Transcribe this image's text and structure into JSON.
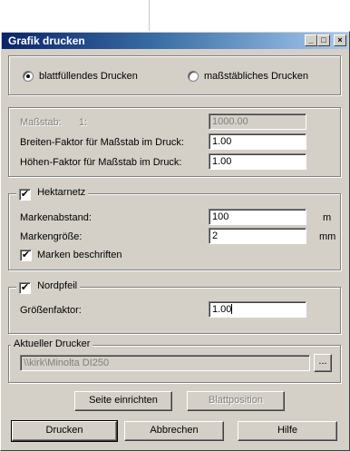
{
  "window": {
    "title": "Grafik drucken",
    "controls": {
      "minimize": "_",
      "maximize": "□",
      "close": "×"
    }
  },
  "print_mode": {
    "options": [
      "blattfüllendes Drucken",
      "maßstäbliches Drucken"
    ],
    "selected": "blattfüllendes Drucken"
  },
  "scale": {
    "label": "Maßstab:",
    "prefix": "1:",
    "value": "1000.00",
    "width_factor_label": "Breiten-Faktor für Maßstab im Druck:",
    "width_factor_value": "1.00",
    "height_factor_label": "Höhen-Faktor für Maßstab im Druck:",
    "height_factor_value": "1.00"
  },
  "grid": {
    "title": "Hektarnetz",
    "checked": true,
    "spacing_label": "Markenabstand:",
    "spacing_value": "100",
    "spacing_unit": "m",
    "size_label": "Markengröße:",
    "size_value": "2",
    "size_unit": "mm",
    "label_marks": "Marken beschriften",
    "label_marks_checked": true
  },
  "north_arrow": {
    "title": "Nordpfeil",
    "checked": true,
    "factor_label": "Größenfaktor:",
    "factor_value": "1.00"
  },
  "printer": {
    "title": "Aktueller Drucker",
    "value": "\\\\kirk\\Minolta DI250",
    "browse_label": "..."
  },
  "buttons": {
    "page_setup": "Seite einrichten",
    "page_position": "Blattposition",
    "print": "Drucken",
    "cancel": "Abbrechen",
    "help": "Hilfe"
  }
}
